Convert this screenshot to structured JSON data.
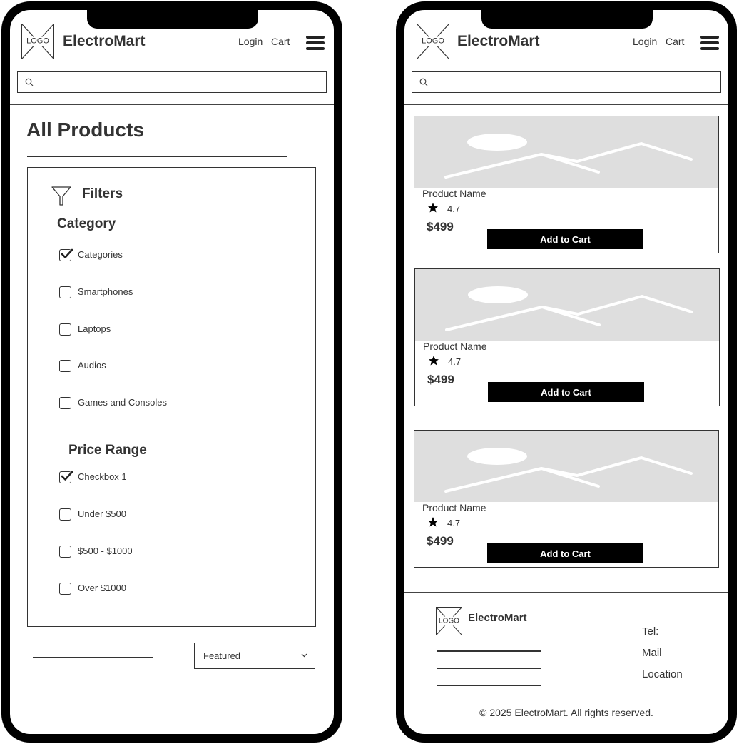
{
  "header": {
    "logo_text": "LOGO",
    "brand": "ElectroMart",
    "login_label": "Login",
    "cart_label": "Cart"
  },
  "search": {
    "placeholder": ""
  },
  "catalog": {
    "title": "All Products",
    "filters_label": "Filters",
    "category_title": "Category",
    "categories": [
      {
        "label": "Categories",
        "checked": true
      },
      {
        "label": "Smartphones",
        "checked": false
      },
      {
        "label": "Laptops",
        "checked": false
      },
      {
        "label": "Audios",
        "checked": false
      },
      {
        "label": "Games and Consoles",
        "checked": false
      }
    ],
    "price_title": "Price Range",
    "prices": [
      {
        "label": "Checkbox 1",
        "checked": true
      },
      {
        "label": "Under $500",
        "checked": false
      },
      {
        "label": "$500 - $1000",
        "checked": false
      },
      {
        "label": "Over $1000",
        "checked": false
      }
    ],
    "sort_value": "Featured"
  },
  "products": [
    {
      "name": "Product Name",
      "rating": "4.7",
      "price": "$499",
      "button": "Add to Cart"
    },
    {
      "name": "Product Name",
      "rating": "4.7",
      "price": "$499",
      "button": "Add to Cart"
    },
    {
      "name": "Product Name",
      "rating": "4.7",
      "price": "$499",
      "button": "Add to Cart"
    }
  ],
  "footer": {
    "logo_text": "LOGO",
    "brand": "ElectroMart",
    "tel": "Tel:",
    "mail": "Mail",
    "location": "Location",
    "copyright": "© 2025 ElectroMart. All rights reserved."
  },
  "colors": {
    "frame": "#000000",
    "text": "#333333",
    "image_placeholder": "#dedede",
    "button_bg": "#000000",
    "button_text": "#ffffff"
  }
}
